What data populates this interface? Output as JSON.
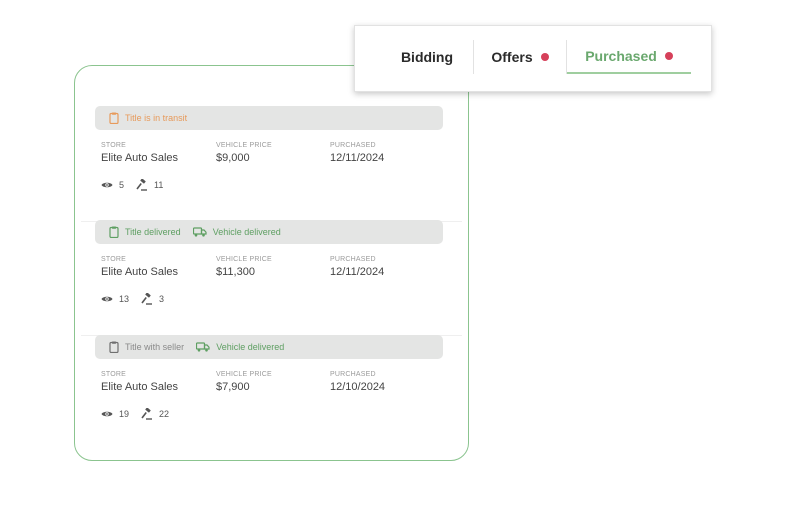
{
  "colors": {
    "accent": "#6aa86e",
    "card_border": "#8bc48f",
    "status_orange": "#e79a5b",
    "status_green": "#5e9f62",
    "status_gray": "#8a8a8a",
    "badge_dot": "#d6405a"
  },
  "tabs": [
    {
      "label": "Bidding",
      "has_dot": false,
      "active": false
    },
    {
      "label": "Offers",
      "has_dot": true,
      "active": false
    },
    {
      "label": "Purchased",
      "has_dot": true,
      "active": true
    }
  ],
  "labels": {
    "store": "STORE",
    "vehicle_price": "VEHICLE PRICE",
    "purchased": "PURCHASED"
  },
  "listings": [
    {
      "statuses": [
        {
          "text": "Title is in transit",
          "icon": "clipboard-icon",
          "color": "orange"
        }
      ],
      "store": "Elite Auto Sales",
      "price": "$9,000",
      "purchased": "12/11/2024",
      "views": "5",
      "bids": "11"
    },
    {
      "statuses": [
        {
          "text": "Title delivered",
          "icon": "clipboard-icon",
          "color": "green"
        },
        {
          "text": "Vehicle delivered",
          "icon": "truck-icon",
          "color": "green"
        }
      ],
      "store": "Elite Auto Sales",
      "price": "$11,300",
      "purchased": "12/11/2024",
      "views": "13",
      "bids": "3"
    },
    {
      "statuses": [
        {
          "text": "Title with seller",
          "icon": "clipboard-icon",
          "color": "gray"
        },
        {
          "text": "Vehicle delivered",
          "icon": "truck-icon",
          "color": "green"
        }
      ],
      "store": "Elite Auto Sales",
      "price": "$7,900",
      "purchased": "12/10/2024",
      "views": "19",
      "bids": "22"
    }
  ]
}
